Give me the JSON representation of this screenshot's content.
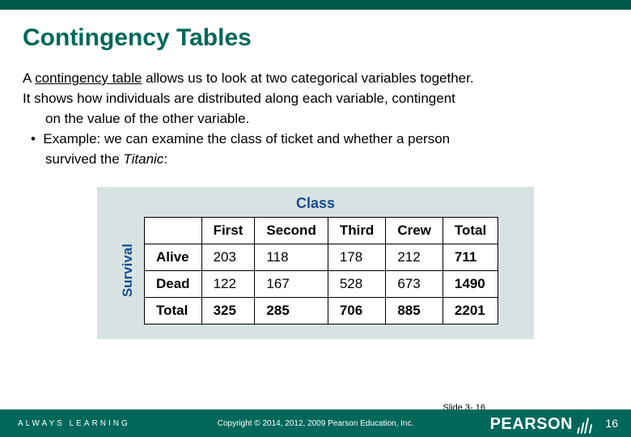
{
  "title": "Contingency Tables",
  "body": {
    "line1_pre": "A ",
    "line1_underlined": "contingency table",
    "line1_post": " allows us to look at two categorical variables together.",
    "line2": "It shows how individuals are distributed along each variable, contingent",
    "line3": "on the value of the other variable.",
    "line4_pre": "Example: we can examine the class of ticket and whether a person",
    "line5_pre": "survived the ",
    "line5_italic": "Titanic",
    "line5_post": ":"
  },
  "table": {
    "top_label": "Class",
    "side_label": "Survival",
    "col_headers": [
      "First",
      "Second",
      "Third",
      "Crew",
      "Total"
    ],
    "rows": [
      {
        "label": "Alive",
        "cells": [
          "203",
          "118",
          "178",
          "212",
          "711"
        ]
      },
      {
        "label": "Dead",
        "cells": [
          "122",
          "167",
          "528",
          "673",
          "1490"
        ]
      },
      {
        "label": "Total",
        "cells": [
          "325",
          "285",
          "706",
          "885",
          "2201"
        ]
      }
    ]
  },
  "footer": {
    "always": "ALWAYS LEARNING",
    "copyright": "Copyright © 2014, 2012, 2009 Pearson Education, Inc.",
    "slide_label": "Slide 3- 16",
    "brand": "PEARSON",
    "page": "16"
  },
  "chart_data": {
    "type": "table",
    "title": "Titanic survival by ticket class (contingency table)",
    "row_variable": "Survival",
    "col_variable": "Class",
    "columns": [
      "First",
      "Second",
      "Third",
      "Crew",
      "Total"
    ],
    "rows": [
      {
        "label": "Alive",
        "values": [
          203,
          118,
          178,
          212,
          711
        ]
      },
      {
        "label": "Dead",
        "values": [
          122,
          167,
          528,
          673,
          1490
        ]
      },
      {
        "label": "Total",
        "values": [
          325,
          285,
          706,
          885,
          2201
        ]
      }
    ]
  }
}
